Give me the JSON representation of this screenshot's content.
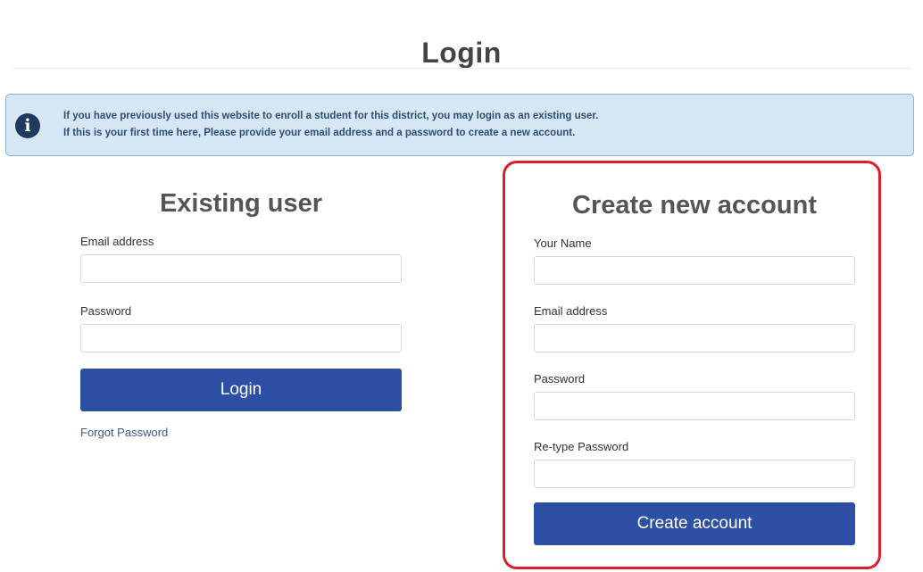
{
  "page": {
    "title": "Login"
  },
  "info_banner": {
    "icon": "info-icon",
    "line1": "If you have previously used this website to enroll a student for this district, you may login as an existing user.",
    "line2": "If this is your first time here, Please provide your email address and a password to create a new account."
  },
  "existing_user": {
    "heading": "Existing user",
    "email_label": "Email address",
    "email_value": "",
    "password_label": "Password",
    "password_value": "",
    "login_button": "Login",
    "forgot_link": "Forgot Password"
  },
  "create_account": {
    "heading": "Create new account",
    "name_label": "Your Name",
    "name_value": "",
    "email_label": "Email address",
    "email_value": "",
    "password_label": "Password",
    "password_value": "",
    "retype_label": "Re-type Password",
    "retype_value": "",
    "create_button": "Create account"
  },
  "colors": {
    "primary_button": "#2d50a5",
    "banner_background": "#d6e7f3",
    "banner_border": "#8ab4d6",
    "highlight_border": "#d91f2a"
  }
}
